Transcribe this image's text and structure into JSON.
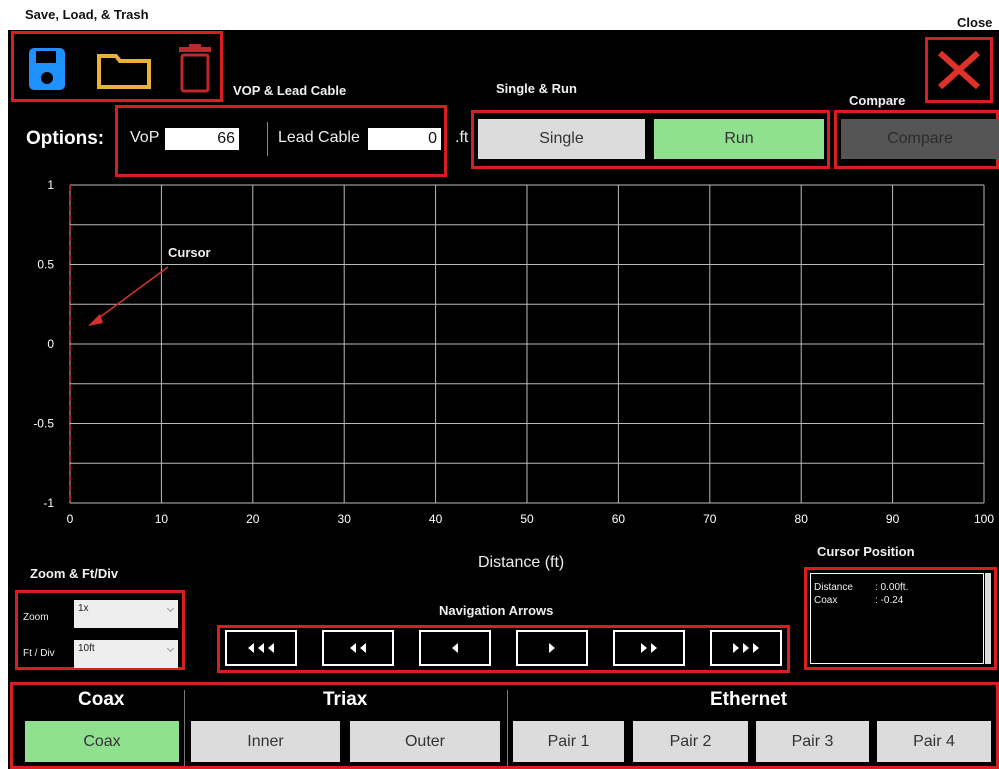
{
  "annotations": {
    "save_load_trash": "Save, Load, & Trash",
    "close": "Close",
    "vop_lead": "VOP & Lead Cable",
    "single_run": "Single & Run",
    "compare": "Compare",
    "cursor": "Cursor",
    "zoom_ftdiv": "Zoom & Ft/Div",
    "navigation_arrows": "Navigation Arrows",
    "cursor_position": "Cursor Position"
  },
  "options": {
    "label": "Options:",
    "vop_label": "VoP",
    "vop_value": "66",
    "lead_label": "Lead Cable",
    "lead_value": "0",
    "lead_unit": ".ft"
  },
  "actions": {
    "single": "Single",
    "run": "Run",
    "compare": "Compare"
  },
  "chart_data": {
    "type": "line",
    "xlabel": "Distance (ft)",
    "xlim": [
      0,
      100
    ],
    "ylim": [
      -1,
      1
    ],
    "x_ticks": [
      "0",
      "10",
      "20",
      "30",
      "40",
      "50",
      "60",
      "70",
      "80",
      "90",
      "100"
    ],
    "y_ticks": [
      "1",
      "0.5",
      "0",
      "-0.5",
      "-1"
    ],
    "grid": true,
    "series": [],
    "cursor_x": 0
  },
  "zoom": {
    "zoom_label": "Zoom",
    "zoom_value": "1x",
    "ftdiv_label": "Ft / Div",
    "ftdiv_value": "10ft"
  },
  "cursor_position": {
    "distance_label": "Distance",
    "distance_value": ": 0.00ft.",
    "coax_label": "Coax",
    "coax_value": ": -0.24"
  },
  "cable_types": {
    "coax_header": "Coax",
    "triax_header": "Triax",
    "ethernet_header": "Ethernet",
    "coax_btn": "Coax",
    "inner": "Inner",
    "outer": "Outer",
    "pair1": "Pair 1",
    "pair2": "Pair 2",
    "pair3": "Pair 3",
    "pair4": "Pair 4"
  },
  "colors": {
    "accent_red": "#d81e1e",
    "active_green": "#8fe08f",
    "save_blue": "#1e90ff",
    "folder_yellow": "#e8b13a"
  }
}
